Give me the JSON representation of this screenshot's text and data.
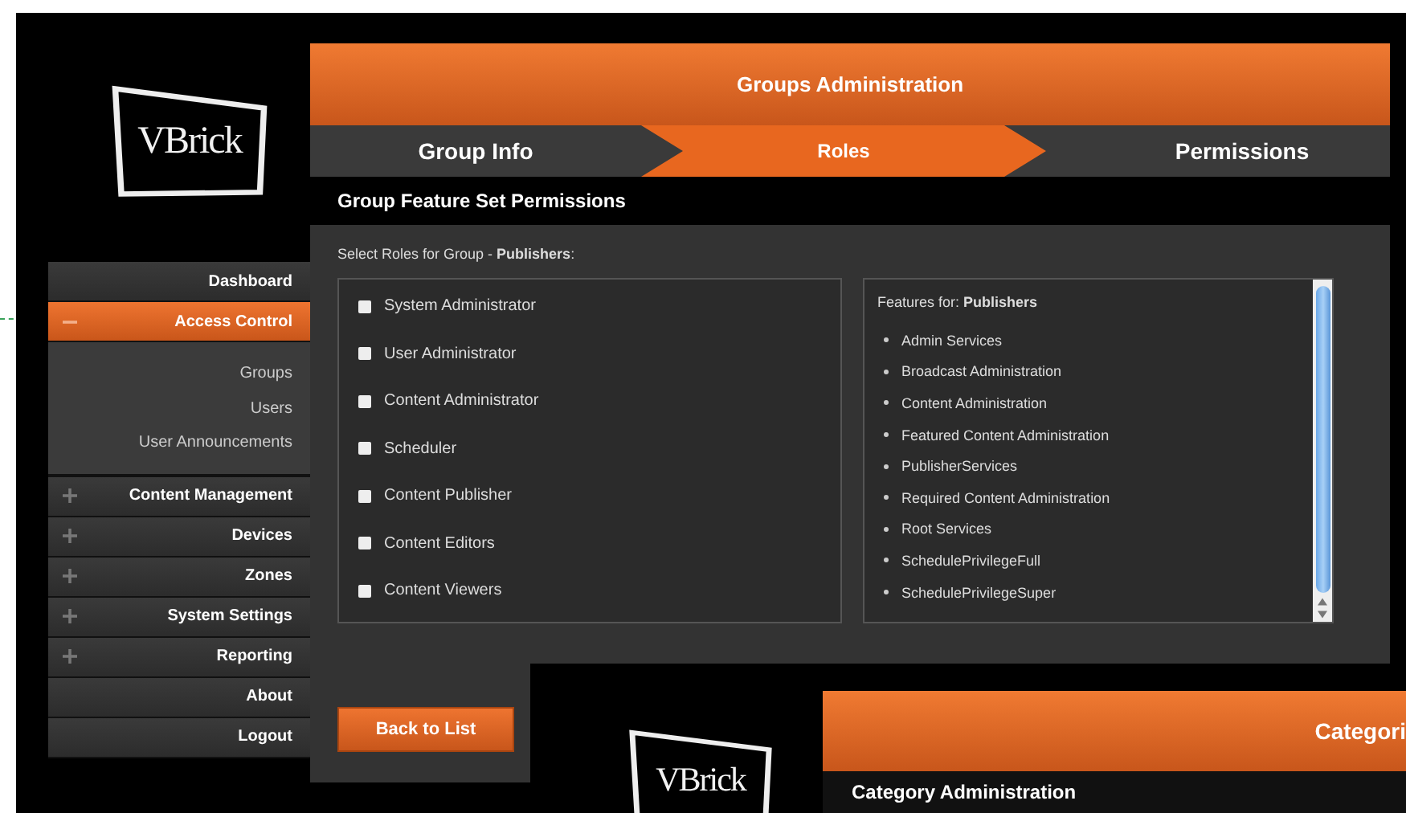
{
  "logo": {
    "text": "VBrick"
  },
  "sidebar": {
    "items": [
      {
        "label": "Dashboard",
        "selected": false
      },
      {
        "label": "Access Control",
        "selected": true,
        "expanded": true,
        "children": [
          {
            "label": "Groups"
          },
          {
            "label": "Users"
          },
          {
            "label": "User Announcements"
          }
        ]
      },
      {
        "label": "Content Management",
        "selected": false,
        "expanded": false
      },
      {
        "label": "Devices",
        "selected": false,
        "expanded": false
      },
      {
        "label": "Zones",
        "selected": false,
        "expanded": false
      },
      {
        "label": "System Settings",
        "selected": false,
        "expanded": false
      },
      {
        "label": "Reporting",
        "selected": false,
        "expanded": false
      },
      {
        "label": "About",
        "selected": false
      },
      {
        "label": "Logout",
        "selected": false
      }
    ]
  },
  "window": {
    "title": "Groups Administration"
  },
  "steps": [
    {
      "label": "Group Info",
      "selected": false
    },
    {
      "label": "Roles",
      "selected": true
    },
    {
      "label": "Permissions",
      "selected": false
    }
  ],
  "section_title": "Group Feature Set Permissions",
  "roles_prompt": "Select Roles for Group - **Publishers**:",
  "roles": [
    {
      "label": "System Administrator",
      "checked": false
    },
    {
      "label": "User Administrator",
      "checked": false
    },
    {
      "label": "Content Administrator",
      "checked": false
    },
    {
      "label": "Scheduler",
      "checked": false
    },
    {
      "label": "Content Publisher",
      "checked": false
    },
    {
      "label": "Content Editors",
      "checked": false
    },
    {
      "label": "Content Viewers",
      "checked": false
    }
  ],
  "features": {
    "heading": "Features for: **Publishers**",
    "items": [
      "Admin Services",
      "Broadcast Administration",
      "Content Administration",
      "Featured Content Administration",
      "PublisherServices",
      "Required Content Administration",
      "Root Services",
      "SchedulePrivilegeFull",
      "SchedulePrivilegeSuper"
    ]
  },
  "back_button": "Back to List",
  "second_window": {
    "logo_text": "VBrick",
    "title": "Categori",
    "section_title": "Category Administration"
  }
}
